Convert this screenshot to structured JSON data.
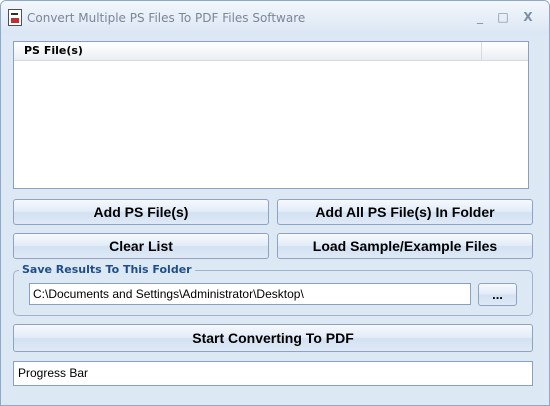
{
  "window": {
    "title": "Convert Multiple PS Files To PDF Files Software",
    "icon": "app-document-icon"
  },
  "titlebar_buttons": {
    "minimize": "_",
    "maximize": "□",
    "close": "X"
  },
  "file_list": {
    "columns": [
      "PS File(s)"
    ],
    "rows": []
  },
  "buttons": {
    "add_files": "Add PS File(s)",
    "add_folder": "Add All PS File(s) In Folder",
    "clear_list": "Clear List",
    "load_samples": "Load Sample/Example Files",
    "browse": "...",
    "start": "Start Converting To PDF"
  },
  "output": {
    "group_label": "Save Results To This Folder",
    "folder_path": "C:\\Documents and Settings\\Administrator\\Desktop\\"
  },
  "progress": {
    "label": "Progress Bar"
  },
  "colors": {
    "window_bg": "#dde8f5",
    "group_label": "#1f4e8c",
    "border": "#8aa0bd"
  }
}
